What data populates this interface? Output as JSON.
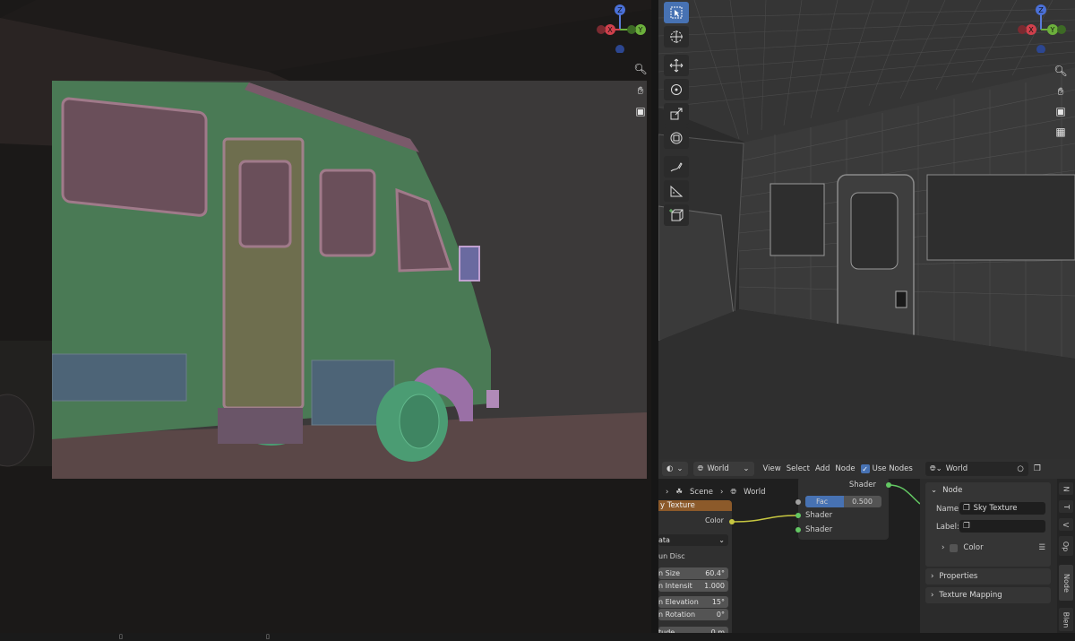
{
  "left_viewport": {
    "gizmo": {
      "z": "Z",
      "y": "Y",
      "x": "X"
    },
    "nav_icons": [
      "zoom-icon",
      "hand-pan-icon",
      "camera-icon"
    ]
  },
  "right_viewport": {
    "gizmo": {
      "z": "Z",
      "y": "Y",
      "x": "X"
    },
    "nav_icons": [
      "zoom-icon",
      "hand-pan-icon",
      "camera-icon",
      "grid-icon"
    ]
  },
  "tools": [
    "select-box-icon",
    "cursor-icon",
    "move-icon",
    "rotate-icon",
    "scale-icon",
    "transform-icon",
    "annotate-icon",
    "measure-icon",
    "add-cube-icon"
  ],
  "node_editor": {
    "header": {
      "editor_type_icon": "node-editor-icon",
      "world_select": "World",
      "menus": [
        "View",
        "Select",
        "Add",
        "Node"
      ],
      "use_nodes_label": "Use Nodes",
      "use_nodes_checked": true,
      "world_datablock": "World"
    },
    "breadcrumb": {
      "scene": "Scene",
      "world": "World"
    },
    "sky_node": {
      "title": "y Texture",
      "color_output": "Color",
      "type_value": "ata",
      "sun_disc": "un Disc",
      "sun_size_label": "n Size",
      "sun_size_value": "60.4°",
      "sun_intensity_label": "n Intensit",
      "sun_intensity_value": "1.000",
      "sun_elevation_label": "n Elevation",
      "sun_elevation_value": "15°",
      "sun_rotation_label": "n Rotation",
      "sun_rotation_value": "0°",
      "altitude_label": "tude",
      "altitude_value": "0 m"
    },
    "mix_node": {
      "output": "Shader",
      "fac_label": "Fac",
      "fac_value": "0.500",
      "fac_fraction": 0.5,
      "input1": "Shader",
      "input2": "Shader"
    },
    "sidebar": {
      "node_panel": "Node",
      "name_label": "Name:",
      "name_value": "Sky Texture",
      "label_label": "Label:",
      "label_value": "",
      "color_label": "Color",
      "properties_label": "Properties",
      "texture_mapping_label": "Texture Mapping"
    },
    "tabs": [
      "N",
      "T",
      "V",
      "Op",
      "Node",
      "Blen"
    ]
  }
}
